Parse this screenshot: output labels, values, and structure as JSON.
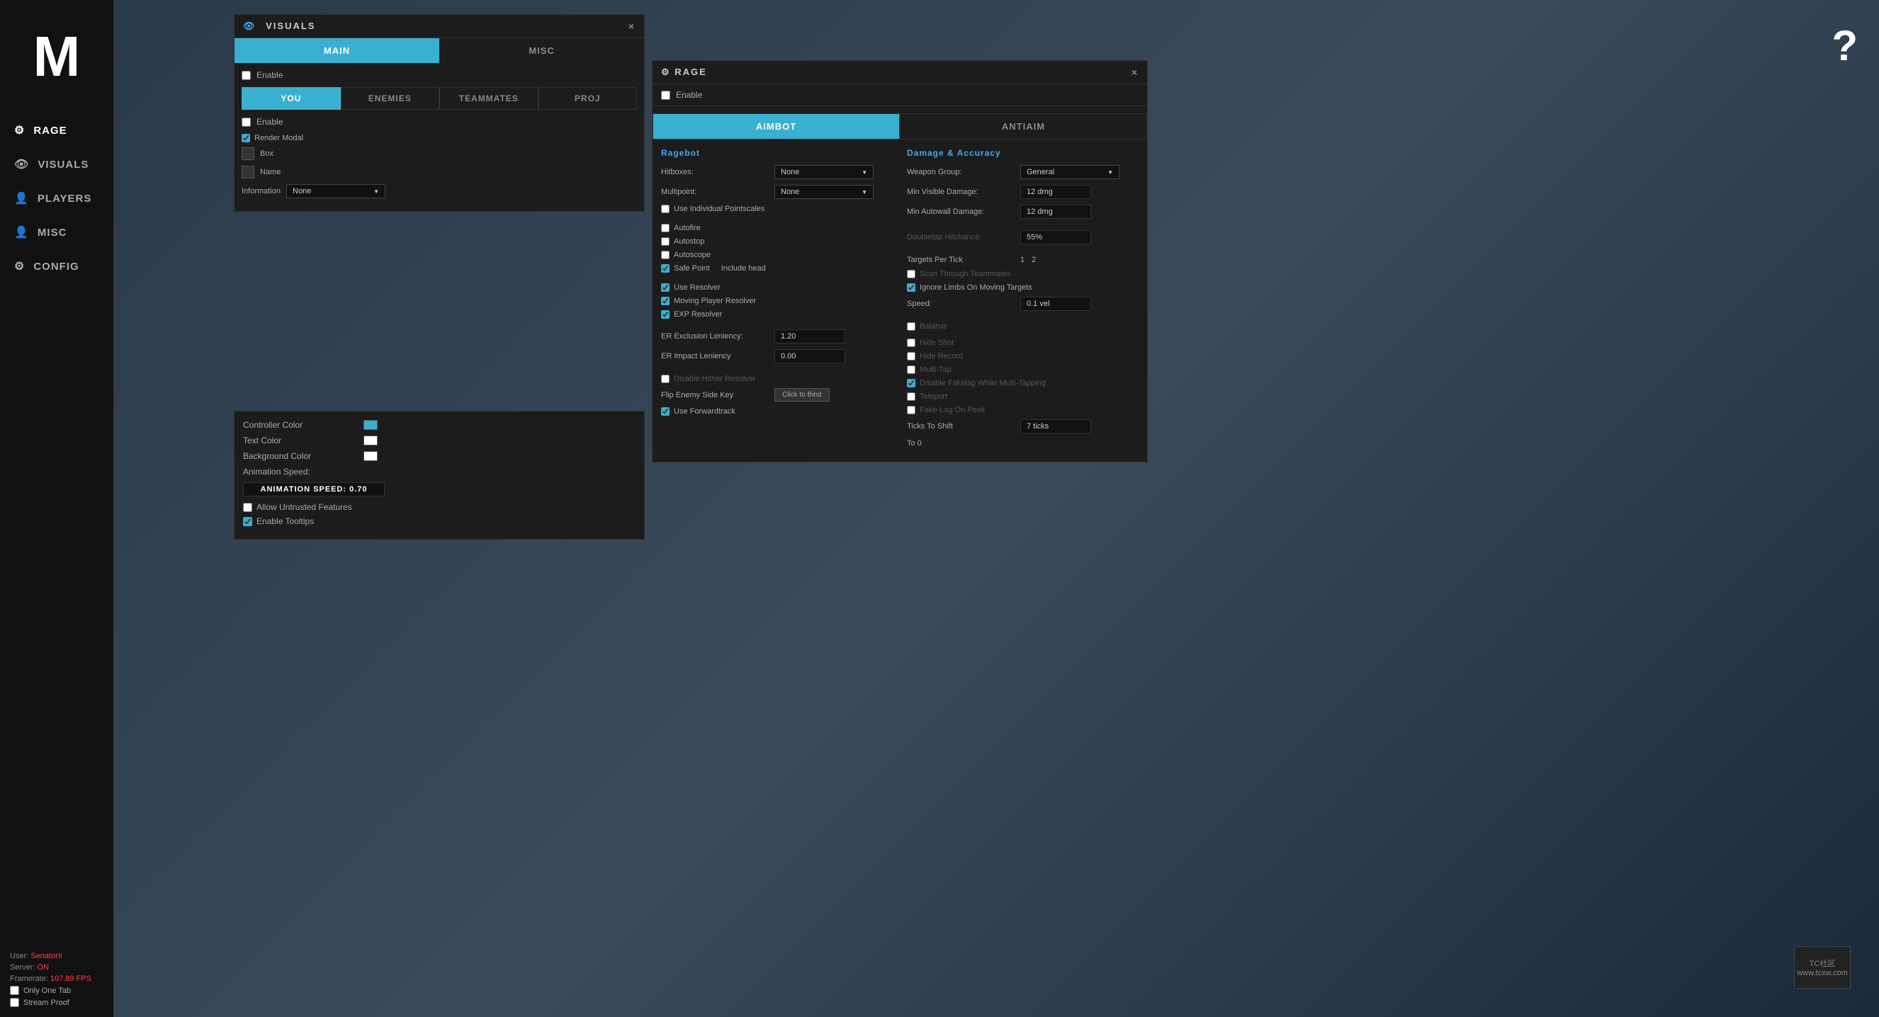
{
  "sidebar": {
    "logo": "M",
    "items": [
      {
        "id": "rage",
        "label": "RAGE",
        "icon": "⚙"
      },
      {
        "id": "visuals",
        "label": "VISUALS",
        "icon": "👁"
      },
      {
        "id": "players",
        "label": "PLAYERS",
        "icon": "👤"
      },
      {
        "id": "misc",
        "label": "MISC",
        "icon": "👤"
      },
      {
        "id": "config",
        "label": "CONFIG",
        "icon": "⚙"
      }
    ],
    "user_label": "User:",
    "username": "SenatorII",
    "server_label": "Server:",
    "server_status": "ON",
    "framerate_label": "Framerate:",
    "framerate_value": "107.89 FPS",
    "only_one_tab_label": "Only One Tab",
    "stream_proof_label": "Stream Proof"
  },
  "visuals_dialog": {
    "title": "VISUALS",
    "close_label": "×",
    "tabs": [
      {
        "id": "main",
        "label": "MAIN",
        "active": true
      },
      {
        "id": "misc",
        "label": "MISC",
        "active": false
      }
    ],
    "enable_label": "Enable",
    "sub_tabs": [
      {
        "id": "you",
        "label": "YOU",
        "active": true
      },
      {
        "id": "enemies",
        "label": "ENEMIES",
        "active": false
      },
      {
        "id": "teammates",
        "label": "TEAMMATES",
        "active": false
      },
      {
        "id": "proj",
        "label": "PROJ",
        "active": false
      }
    ],
    "inner_enable": "Enable",
    "render_modal": "Render Modal",
    "box_label": "Box",
    "name_label": "Name",
    "information_label": "Information",
    "information_value": "None"
  },
  "controller_panel": {
    "controller_color_label": "Controller Color",
    "text_color_label": "Text Color",
    "background_color_label": "Background Color",
    "animation_speed_label": "Animation Speed:",
    "animation_speed_text": "ANIMATION SPEED: 0.70",
    "allow_untrusted_label": "Allow Untrusted Features",
    "enable_tooltips_label": "Enable Tooltips"
  },
  "rage_dialog": {
    "title": "RAGE",
    "close_label": "×",
    "enable_label": "Enable",
    "tabs": [
      {
        "id": "aimbot",
        "label": "AIMBOT",
        "active": true
      },
      {
        "id": "antiaim",
        "label": "ANTIAIM",
        "active": false
      }
    ],
    "ragebot_title": "Ragebot",
    "hitboxes_label": "Hitboxes:",
    "hitboxes_value": "None",
    "multipoint_label": "Multipoint:",
    "multipoint_value": "None",
    "use_individual_pointscales": "Use Individual Pointscales",
    "autofire_label": "Autofire",
    "autostop_label": "Autostop",
    "autoscope_label": "Autoscope",
    "safe_point_label": "Safe Point",
    "include_head_label": "Include head",
    "use_resolver_label": "Use Resolver",
    "moving_player_resolver_label": "Moving Player Resolver",
    "exp_resolver_label": "EXP Resolver",
    "er_exclusion_leniency_label": "ER Exclusion Leniency:",
    "er_exclusion_leniency_value": "1.20",
    "er_impact_leniency_label": "ER Impact Leniency",
    "er_impact_leniency_value": "0.00",
    "disable_hither_resolver_label": "Disable Hither Resolver",
    "flip_enemy_side_key_label": "Flip Enemy Side Key",
    "flip_enemy_side_btn": "Click to Bind",
    "use_forwardtrack_label": "Use Forwardtrack",
    "damage_accuracy_title": "Damage & Accuracy",
    "weapon_group_label": "Weapon Group:",
    "weapon_group_value": "General",
    "min_visible_damage_label": "Min Visible Damage:",
    "min_visible_damage_value": "12 dmg",
    "min_autowall_damage_label": "Min Autowall Damage:",
    "min_autowall_damage_value": "12 dmg",
    "doubletap_hitchance_label": "Doubletap Hitchance:",
    "doubletap_hitchance_value": "55%",
    "targets_per_tick_label": "Targets Per Tick",
    "targets_per_tick_v1": "1",
    "targets_per_tick_v2": "2",
    "scan_through_teammates_label": "Scan Through Teammates",
    "ignore_limbs_label": "Ignore Limbs On Moving Targets",
    "speed_label": "Speed:",
    "speed_value": "0.1 vel",
    "balatsis_label": "Balatsis",
    "hide_shot_label": "Hide Shot",
    "hide_record_label": "Hide Record",
    "multi_tap_label": "Multi-Tap",
    "disable_fakelag_label": "Disable Fakelag While Multi-Tapping",
    "teleport_label": "Teleport",
    "fake_lag_on_peek_label": "Fake-Lag On Peek",
    "ticks_to_shift_label": "Ticks To Shift",
    "ticks_to_shift_value": "7 ticks",
    "to_0_label": "To 0"
  },
  "bottom": {
    "ticks_label": "7 ticks"
  }
}
